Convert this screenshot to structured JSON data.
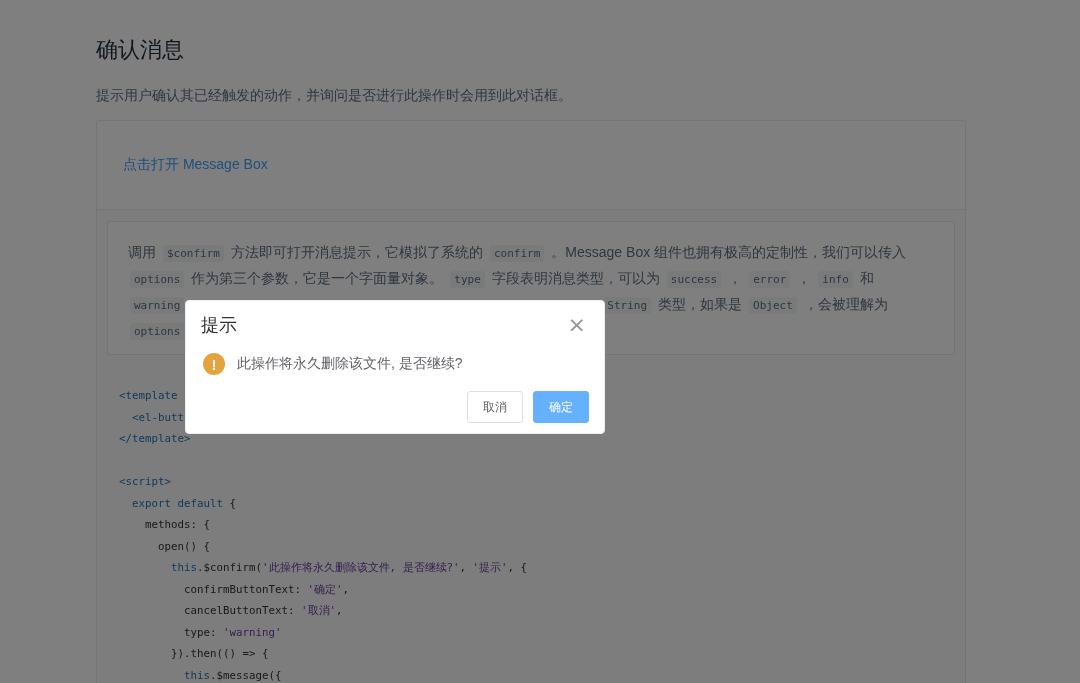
{
  "page": {
    "title": "确认消息",
    "description": "提示用户确认其已经触发的动作，并询问是否进行此操作时会用到此对话框。"
  },
  "demo": {
    "link": "点击打开 Message Box",
    "description_lines": [
      {
        "left": [
          {
            "kind": "text",
            "text": "调用"
          },
          {
            "kind": "code",
            "text": "$confirm"
          },
          {
            "kind": "text",
            "text": "方法即可打开消息提示，它模拟了系统的"
          },
          {
            "kind": "code",
            "text": "confirm"
          },
          {
            "kind": "text",
            "text": "。Message Box 组件也拥有极高的定制性，我们可以传入"
          }
        ]
      },
      {
        "left": [
          {
            "kind": "code",
            "text": "options"
          },
          {
            "kind": "text",
            "text": "作为第三个参数，它是一个字面量对象。"
          },
          {
            "kind": "code",
            "text": "type"
          },
          {
            "kind": "text",
            "text": "字段表明消息类型，可以为"
          },
          {
            "kind": "code",
            "text": "success"
          },
          {
            "kind": "text",
            "text": "，"
          },
          {
            "kind": "code",
            "text": "error"
          },
          {
            "kind": "text",
            "text": "，"
          },
          {
            "kind": "code",
            "text": "info"
          },
          {
            "kind": "text",
            "text": "和"
          }
        ]
      },
      {
        "left": [
          {
            "kind": "code",
            "text": "warning"
          }
        ],
        "right": [
          {
            "kind": "code",
            "text": "String"
          },
          {
            "kind": "text",
            "text": "类型，如果是"
          },
          {
            "kind": "code",
            "text": "Object"
          },
          {
            "kind": "text",
            "text": "，会被理解为"
          }
        ]
      },
      {
        "left": [
          {
            "kind": "code",
            "text": "options"
          }
        ]
      }
    ],
    "code_blocks": [
      [
        [
          {
            "kind": "tag",
            "text": "<template"
          }
        ],
        [
          {
            "kind": "tag",
            "text": "  <el-butt"
          }
        ],
        [
          {
            "kind": "tag",
            "text": "</template>"
          }
        ]
      ],
      [
        [
          {
            "kind": "tag",
            "text": "<script>"
          }
        ],
        [
          {
            "kind": "kw",
            "text": "  export default"
          },
          {
            "kind": "plain",
            "text": " {"
          }
        ],
        [
          {
            "kind": "plain",
            "text": "    methods: {"
          }
        ],
        [
          {
            "kind": "plain",
            "text": "      open() {"
          }
        ],
        [
          {
            "kind": "kw",
            "text": "        this"
          },
          {
            "kind": "plain",
            "text": ".$confirm("
          },
          {
            "kind": "str",
            "text": "'此操作将永久删除该文件, 是否继续?'"
          },
          {
            "kind": "plain",
            "text": ", "
          },
          {
            "kind": "str",
            "text": "'提示'"
          },
          {
            "kind": "plain",
            "text": ", {"
          }
        ],
        [
          {
            "kind": "plain",
            "text": "          confirmButtonText: "
          },
          {
            "kind": "str",
            "text": "'确定'"
          },
          {
            "kind": "plain",
            "text": ","
          }
        ],
        [
          {
            "kind": "plain",
            "text": "          cancelButtonText: "
          },
          {
            "kind": "str",
            "text": "'取消'"
          },
          {
            "kind": "plain",
            "text": ","
          }
        ],
        [
          {
            "kind": "plain",
            "text": "          type: "
          },
          {
            "kind": "str",
            "text": "'warning'"
          }
        ],
        [
          {
            "kind": "plain",
            "text": "        }).then(() => {"
          }
        ],
        [
          {
            "kind": "kw",
            "text": "          this"
          },
          {
            "kind": "plain",
            "text": ".$message({"
          }
        ]
      ]
    ]
  },
  "dialog": {
    "title": "提示",
    "close": "×",
    "icon_glyph": "!",
    "message": "此操作将永久删除该文件, 是否继续?",
    "cancel": "取消",
    "confirm": "确定"
  }
}
